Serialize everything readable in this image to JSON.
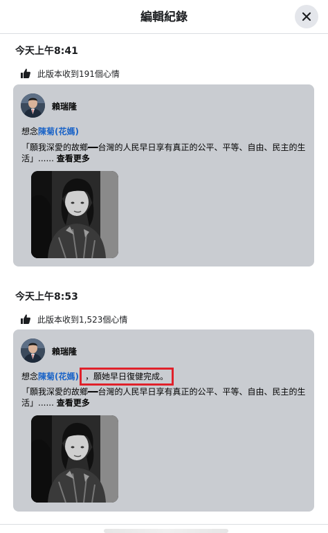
{
  "modal": {
    "title": "編輯紀錄",
    "close_icon": "close-icon"
  },
  "versions": [
    {
      "time": "今天上午8:41",
      "reactions": "此版本收到191個心情",
      "post": {
        "author": "賴瑞隆",
        "prefix": "想念",
        "mention": "陳菊(花媽)",
        "added_text": "",
        "body": "「願我深愛的故鄉━━台灣的人民早日享有真正的公平、平等、自由、民主的生活」......",
        "see_more": "查看更多"
      }
    },
    {
      "time": "今天上午8:53",
      "reactions": "此版本收到1,523個心情",
      "post": {
        "author": "賴瑞隆",
        "prefix": "想念",
        "mention": "陳菊(花媽)",
        "added_text": "，願她早日復健完成。",
        "body": "「願我深愛的故鄉━━台灣的人民早日享有真正的公平、平等、自由、民主的生活」......",
        "see_more": "查看更多"
      }
    }
  ],
  "colors": {
    "card_bg": "#c9ccd1",
    "mention": "#1a63c7",
    "highlight_border": "#e0202a"
  }
}
